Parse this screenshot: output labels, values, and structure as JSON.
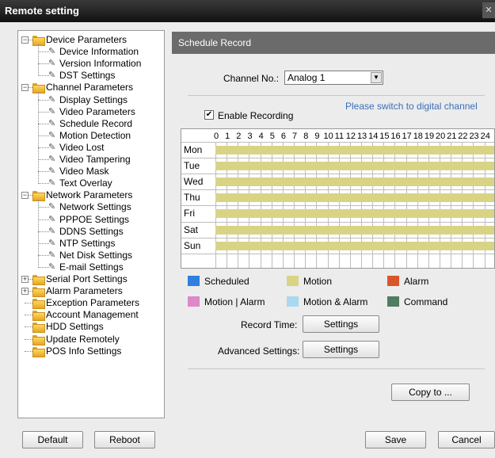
{
  "window": {
    "title": "Remote setting"
  },
  "tree": {
    "items": [
      {
        "label": "Device Parameters",
        "level": 0,
        "kind": "folder",
        "expander": "−"
      },
      {
        "label": "Device Information",
        "level": 1,
        "kind": "leaf"
      },
      {
        "label": "Version Information",
        "level": 1,
        "kind": "leaf"
      },
      {
        "label": "DST Settings",
        "level": 1,
        "kind": "leaf"
      },
      {
        "label": "Channel Parameters",
        "level": 0,
        "kind": "folder",
        "expander": "−"
      },
      {
        "label": "Display Settings",
        "level": 1,
        "kind": "leaf"
      },
      {
        "label": "Video Parameters",
        "level": 1,
        "kind": "leaf"
      },
      {
        "label": "Schedule Record",
        "level": 1,
        "kind": "leaf"
      },
      {
        "label": "Motion Detection",
        "level": 1,
        "kind": "leaf"
      },
      {
        "label": "Video Lost",
        "level": 1,
        "kind": "leaf"
      },
      {
        "label": "Video Tampering",
        "level": 1,
        "kind": "leaf"
      },
      {
        "label": "Video Mask",
        "level": 1,
        "kind": "leaf"
      },
      {
        "label": "Text Overlay",
        "level": 1,
        "kind": "leaf"
      },
      {
        "label": "Network Parameters",
        "level": 0,
        "kind": "folder",
        "expander": "−"
      },
      {
        "label": "Network Settings",
        "level": 1,
        "kind": "leaf"
      },
      {
        "label": "PPPOE Settings",
        "level": 1,
        "kind": "leaf"
      },
      {
        "label": "DDNS Settings",
        "level": 1,
        "kind": "leaf"
      },
      {
        "label": "NTP Settings",
        "level": 1,
        "kind": "leaf"
      },
      {
        "label": "Net Disk Settings",
        "level": 1,
        "kind": "leaf"
      },
      {
        "label": "E-mail Settings",
        "level": 1,
        "kind": "leaf"
      },
      {
        "label": "Serial Port Settings",
        "level": 0,
        "kind": "folder",
        "expander": "+"
      },
      {
        "label": "Alarm Parameters",
        "level": 0,
        "kind": "folder",
        "expander": "+"
      },
      {
        "label": "Exception Parameters",
        "level": 0,
        "kind": "folder",
        "expander": ""
      },
      {
        "label": "Account Management",
        "level": 0,
        "kind": "folder",
        "expander": ""
      },
      {
        "label": "HDD Settings",
        "level": 0,
        "kind": "folder",
        "expander": ""
      },
      {
        "label": "Update Remotely",
        "level": 0,
        "kind": "folder",
        "expander": ""
      },
      {
        "label": "POS Info Settings",
        "level": 0,
        "kind": "folder",
        "expander": ""
      }
    ]
  },
  "panel": {
    "header": "Schedule Record",
    "channel_label": "Channel No.:",
    "channel_value": "Analog 1",
    "enable_recording_label": "Enable Recording",
    "enable_recording_checked": true,
    "hint": "Please switch to digital channel",
    "schedule": {
      "hours": [
        "0",
        "1",
        "2",
        "3",
        "4",
        "5",
        "6",
        "7",
        "8",
        "9",
        "10",
        "11",
        "12",
        "13",
        "14",
        "15",
        "16",
        "17",
        "18",
        "19",
        "20",
        "21",
        "22",
        "23",
        "24"
      ],
      "days": [
        "Mon",
        "Tue",
        "Wed",
        "Thu",
        "Fri",
        "Sat",
        "Sun"
      ],
      "fill_color": "#d9d485",
      "record_type": "Motion"
    },
    "legend": [
      {
        "label": "Scheduled",
        "color": "#2f7fde"
      },
      {
        "label": "Motion",
        "color": "#d9d485"
      },
      {
        "label": "Alarm",
        "color": "#d9562a"
      },
      {
        "label": "Motion | Alarm",
        "color": "#dd88c8"
      },
      {
        "label": "Motion & Alarm",
        "color": "#a9d8f0"
      },
      {
        "label": "Command",
        "color": "#4f7d61"
      }
    ],
    "record_time_label": "Record Time:",
    "record_time_button": "Settings",
    "advanced_label": "Advanced Settings:",
    "advanced_button": "Settings",
    "copy_button": "Copy to ..."
  },
  "footer": {
    "default_button": "Default",
    "reboot_button": "Reboot",
    "save_button": "Save",
    "cancel_button": "Cancel"
  }
}
